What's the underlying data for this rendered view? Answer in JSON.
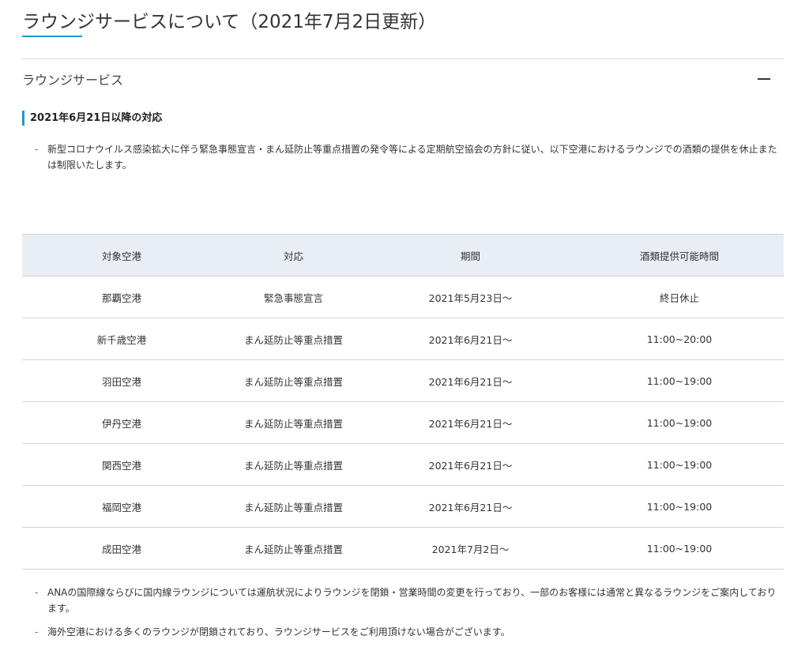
{
  "page": {
    "title": "ラウンジサービスについて（2021年7月2日更新）"
  },
  "accordion": {
    "label": "ラウンジサービス",
    "toggle_symbol": "—"
  },
  "section": {
    "heading": "2021年6月21日以降の対応",
    "intro_bullet": "-",
    "intro_text": "新型コロナウイルス感染拡大に伴う緊急事態宣言・まん延防止等重点措置の発令等による定期航空協会の方針に従い、以下空港におけるラウンジでの酒類の提供を休止または制限いたします。"
  },
  "table": {
    "headers": [
      "対象空港",
      "対応",
      "期間",
      "酒類提供可能時間"
    ],
    "rows": [
      [
        "那覇空港",
        "緊急事態宣言",
        "2021年5月23日～",
        "終日休止"
      ],
      [
        "新千歳空港",
        "まん延防止等重点措置",
        "2021年6月21日～",
        "11:00~20:00"
      ],
      [
        "羽田空港",
        "まん延防止等重点措置",
        "2021年6月21日～",
        "11:00~19:00"
      ],
      [
        "伊丹空港",
        "まん延防止等重点措置",
        "2021年6月21日～",
        "11:00~19:00"
      ],
      [
        "関西空港",
        "まん延防止等重点措置",
        "2021年6月21日～",
        "11:00~19:00"
      ],
      [
        "福岡空港",
        "まん延防止等重点措置",
        "2021年6月21日～",
        "11:00~19:00"
      ],
      [
        "成田空港",
        "まん延防止等重点措置",
        "2021年7月2日～",
        "11:00~19:00"
      ]
    ]
  },
  "notes": [
    "ANAの国際線ならびに国内線ラウンジについては運航状況によりラウンジを閉鎖・営業時間の変更を行っており、一部のお客様には通常と異なるラウンジをご案内しております。",
    "海外空港における多くのラウンジが閉鎖されており、ラウンジサービスをご利用頂けない場合がございます。"
  ],
  "colors": {
    "accent": "#1e96d4",
    "table_header_bg": "#e9eef5"
  }
}
